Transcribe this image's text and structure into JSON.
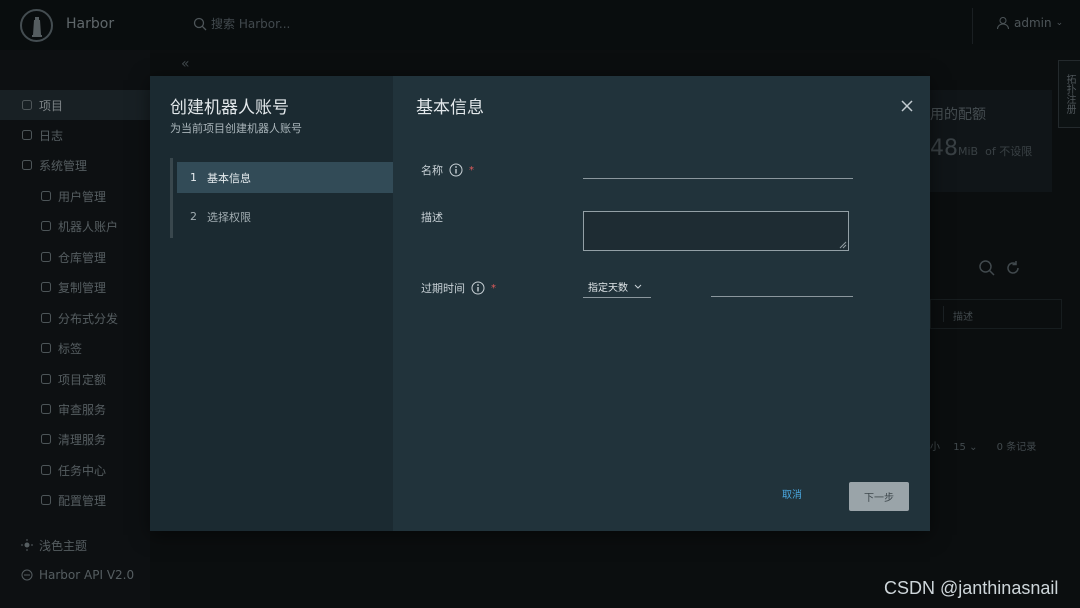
{
  "app": {
    "title": "Harbor",
    "search_placeholder": "搜索 Harbor...",
    "user": "admin"
  },
  "sidebar": {
    "items": [
      {
        "label": "项目",
        "icon": "projects-icon",
        "active": true,
        "top": true
      },
      {
        "label": "日志",
        "icon": "logs-icon",
        "top": true
      },
      {
        "label": "系统管理",
        "icon": "admin-icon",
        "top": true
      },
      {
        "label": "用户管理",
        "icon": "users-icon"
      },
      {
        "label": "机器人账户",
        "icon": "robot-icon"
      },
      {
        "label": "仓库管理",
        "icon": "registry-icon"
      },
      {
        "label": "复制管理",
        "icon": "replication-icon"
      },
      {
        "label": "分布式分发",
        "icon": "distribution-icon"
      },
      {
        "label": "标签",
        "icon": "tag-icon"
      },
      {
        "label": "项目定额",
        "icon": "quota-icon"
      },
      {
        "label": "审查服务",
        "icon": "interrogation-icon"
      },
      {
        "label": "清理服务",
        "icon": "cleanup-icon"
      },
      {
        "label": "任务中心",
        "icon": "job-icon"
      },
      {
        "label": "配置管理",
        "icon": "config-icon"
      }
    ],
    "theme_toggle": "浅色主题",
    "api": "Harbor API V2.0"
  },
  "background": {
    "quota_title": "用的配额",
    "quota_value": "48",
    "quota_unit": "MiB",
    "quota_suffix": "of 不设限",
    "side_tab": "拓扑注册",
    "column_description": "描述",
    "page_size_label": "小",
    "page_size": "15",
    "records": "0 条记录"
  },
  "modal": {
    "title": "创建机器人账号",
    "subtitle": "为当前项目创建机器人账号",
    "steps": [
      {
        "num": "1",
        "label": "基本信息",
        "active": true
      },
      {
        "num": "2",
        "label": "选择权限",
        "active": false
      }
    ],
    "section_title": "基本信息",
    "fields": {
      "name_label": "名称",
      "name_value": "",
      "description_label": "描述",
      "description_value": "",
      "expiration_label": "过期时间",
      "expiration_mode": "指定天数",
      "expiration_days": ""
    },
    "required_mark": "*",
    "cancel": "取消",
    "next": "下一步"
  },
  "watermark": "CSDN @janthinasnail"
}
